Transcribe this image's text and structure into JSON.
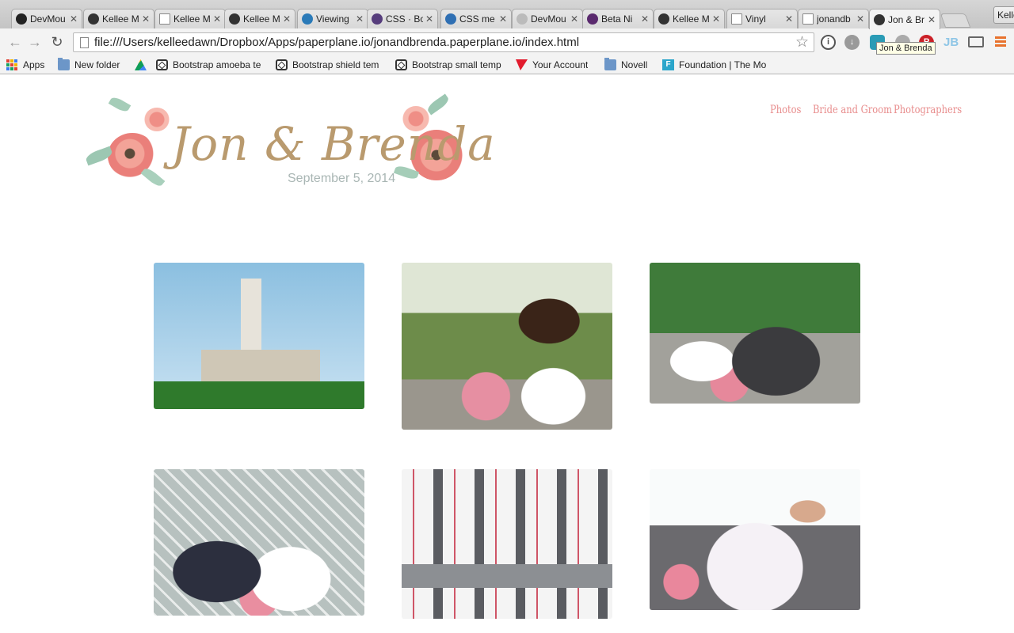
{
  "browser": {
    "tabs": [
      {
        "label": "DevMou",
        "icon": "github-icon",
        "color": "#222222"
      },
      {
        "label": "Kellee M",
        "icon": "circle-a-icon",
        "color": "#333333"
      },
      {
        "label": "Kellee M",
        "icon": "page-icon",
        "color": "#ffffff"
      },
      {
        "label": "Kellee M",
        "icon": "circle-a-icon",
        "color": "#333333"
      },
      {
        "label": "Viewing",
        "icon": "bootsnipp-icon",
        "color": "#2a7ab8"
      },
      {
        "label": "CSS · Bo",
        "icon": "bootstrap-icon",
        "color": "#563d7c"
      },
      {
        "label": "CSS me",
        "icon": "chat-icon",
        "color": "#2f6fb3"
      },
      {
        "label": "DevMou",
        "icon": "spinner-icon",
        "color": "#bbbbbb"
      },
      {
        "label": "Beta Ni",
        "icon": "diamond-icon",
        "color": "#5a2a6e"
      },
      {
        "label": "Kellee M",
        "icon": "circle-a-icon",
        "color": "#333333"
      },
      {
        "label": "Vinyl",
        "icon": "page-icon",
        "color": "#ffffff"
      },
      {
        "label": "jonandb",
        "icon": "page-icon",
        "color": "#ffffff"
      },
      {
        "label": "Jon & Br",
        "icon": "oo-icon",
        "color": "#333333"
      }
    ],
    "profile_name": "Kellee",
    "url": "file:///Users/kelleedawn/Dropbox/Apps/paperplane.io/jonandbrenda.paperplane.io/index.html",
    "tooltip": "Jon & Brenda",
    "bookmarks": [
      {
        "label": "Apps",
        "icon": "apps-grid-icon"
      },
      {
        "label": "New folder",
        "icon": "folder-icon"
      },
      {
        "label": "",
        "icon": "drive-icon"
      },
      {
        "label": "Bootstrap amoeba te",
        "icon": "bootstrap-theme-icon"
      },
      {
        "label": "Bootstrap shield tem",
        "icon": "bootstrap-theme-icon"
      },
      {
        "label": "Bootstrap small temp",
        "icon": "bootstrap-theme-icon"
      },
      {
        "label": "Your Account",
        "icon": "red-flag-icon"
      },
      {
        "label": "Novell",
        "icon": "folder-icon"
      },
      {
        "label": "Foundation | The Mo",
        "icon": "foundation-icon"
      }
    ]
  },
  "site": {
    "logo_title": "Jon & Brenda",
    "logo_date": "September 5, 2014",
    "nav": [
      "Photos",
      "Bride and Groom",
      "Photographers"
    ],
    "colors": {
      "accent": "#e88d8d",
      "script": "#b99a6e"
    },
    "photos": [
      {
        "subject": "temple-photo"
      },
      {
        "subject": "bride-with-bouquet-photo"
      },
      {
        "subject": "couple-kiss-photo"
      },
      {
        "subject": "bride-with-mother-photo"
      },
      {
        "subject": "groomsmen-photo"
      },
      {
        "subject": "bride-hug-photo"
      }
    ]
  }
}
